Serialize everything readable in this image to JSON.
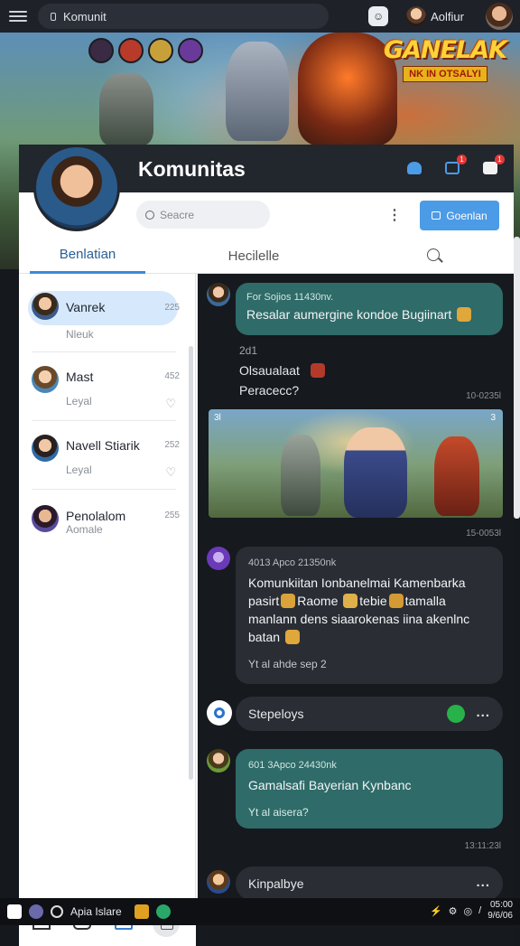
{
  "browser": {
    "address": "Komunit",
    "user_name": "Aolfiur"
  },
  "banner": {
    "logo_title": "GANELAK",
    "logo_subtitle": "NK IN OTSALYI"
  },
  "header": {
    "title": "Komunitas",
    "badge_count": "1"
  },
  "toolbar": {
    "search_placeholder": "Seacre",
    "more_label": "⋮",
    "primary_label": "Goenlan"
  },
  "tabs": [
    {
      "label": "Benlatian"
    },
    {
      "label": "Hecilelle"
    }
  ],
  "contacts": [
    {
      "name": "Vanrek",
      "sub": "Nleuk",
      "count": "225",
      "avatar_color": "#3a5a8a"
    },
    {
      "name": "Mast",
      "sub": "Leyal",
      "count": "452",
      "avatar_color": "#4a86b8"
    },
    {
      "name": "Navell Stiarik",
      "sub": "Leyal",
      "count": "252",
      "avatar_color": "#2f6aa6"
    },
    {
      "name": "Penolalom",
      "sub": "Aomale",
      "count": "255",
      "avatar_color": "#5a4a9a"
    }
  ],
  "chat": {
    "msg1": {
      "meta": "For Sojios 11430nv.",
      "text": "Resalar aumergine kondoe Bugiinart"
    },
    "divider_time": "2d1",
    "msg2": {
      "line1": "Olsaualaat",
      "line2": "Peracecc?",
      "time": "10-0235l"
    },
    "image_time": "15-0053l",
    "msg3": {
      "meta": "4013 Apco 21350nk",
      "l1a": "Komunkiitan Ionbanelmai Kamenbarka",
      "l2a": "pasirt",
      "l2b": "Raome",
      "l2c": "tebie",
      "l2d": "tamalla",
      "l3": "manlann dens siaarokenas iina akenlnc",
      "l4": "batan",
      "footer": "Yt al ahde sep 2"
    },
    "input1": {
      "text": "Stepeloys",
      "dots": "..."
    },
    "msg4": {
      "meta": "601 3Apco 24430nk",
      "text": "Gamalsafi Bayerian Kynbanc",
      "footer": "Yt al aisera?",
      "time": "13:11:23l"
    },
    "input2": {
      "text": "Kinpalbye",
      "dots": "..."
    },
    "game_hud": {
      "left": "3l",
      "right": "3"
    }
  },
  "taskbar": {
    "app_label": "Apia Islare",
    "time": "05:00",
    "date": "9/6/06"
  },
  "colors": {
    "accent": "#4c9be6",
    "chat_bubble": "#2f6b68",
    "badge": "#e23838"
  }
}
